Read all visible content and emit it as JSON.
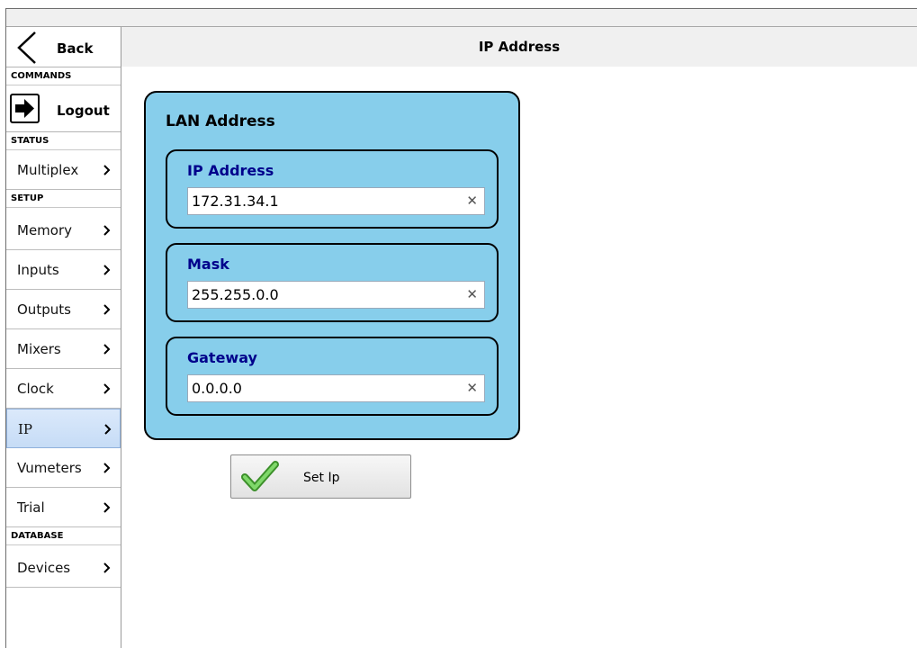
{
  "header": {
    "title": "IP Address"
  },
  "sidebar": {
    "back_label": "Back",
    "sections": {
      "commands": "COMMANDS",
      "status": "STATUS",
      "setup": "SETUP",
      "database": "DATABASE"
    },
    "logout_label": "Logout",
    "items": {
      "multiplex": "Multiplex",
      "memory": "Memory",
      "inputs": "Inputs",
      "outputs": "Outputs",
      "mixers": "Mixers",
      "clock": "Clock",
      "ip": "IP",
      "vumeters": "Vumeters",
      "trial": "Trial",
      "devices": "Devices"
    },
    "active_item": "IP"
  },
  "lan": {
    "title": "LAN Address",
    "ip": {
      "label": "IP Address",
      "value": "172.31.34.1"
    },
    "mask": {
      "label": "Mask",
      "value": "255.255.0.0"
    },
    "gateway": {
      "label": "Gateway",
      "value": "0.0.0.0"
    },
    "clear_glyph": "✕"
  },
  "actions": {
    "set_ip_label": "Set Ip"
  },
  "colors": {
    "panel_bg": "#87ceeb",
    "field_label": "#00008b",
    "active_nav": "#c6dcf6"
  }
}
